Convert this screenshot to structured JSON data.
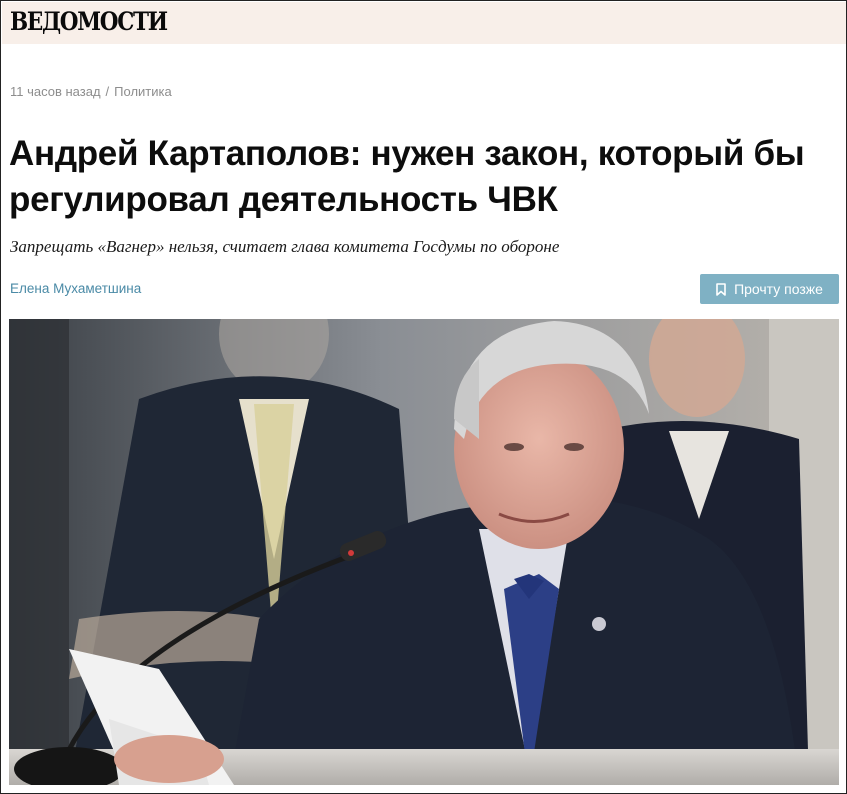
{
  "site": {
    "logo": "ВЕДОМОСТИ"
  },
  "article": {
    "time_ago": "11 часов назад",
    "separator": "/",
    "rubric": "Политика",
    "title": "Андрей Картаполов: нужен закон, который бы регулировал деятельность ЧВК",
    "subtitle": "Запрещать «Вагнер» нельзя, считает глава комитета Госдумы по обороне",
    "author": "Елена Мухаметшина",
    "read_later_label": "Прочту позже"
  },
  "icons": {
    "bookmark": "bookmark-icon"
  },
  "colors": {
    "topbar_bg": "#f8efe9",
    "accent_link": "#4a8aa6",
    "button_bg": "#7fb1c4",
    "meta_text": "#8d8d8d"
  }
}
